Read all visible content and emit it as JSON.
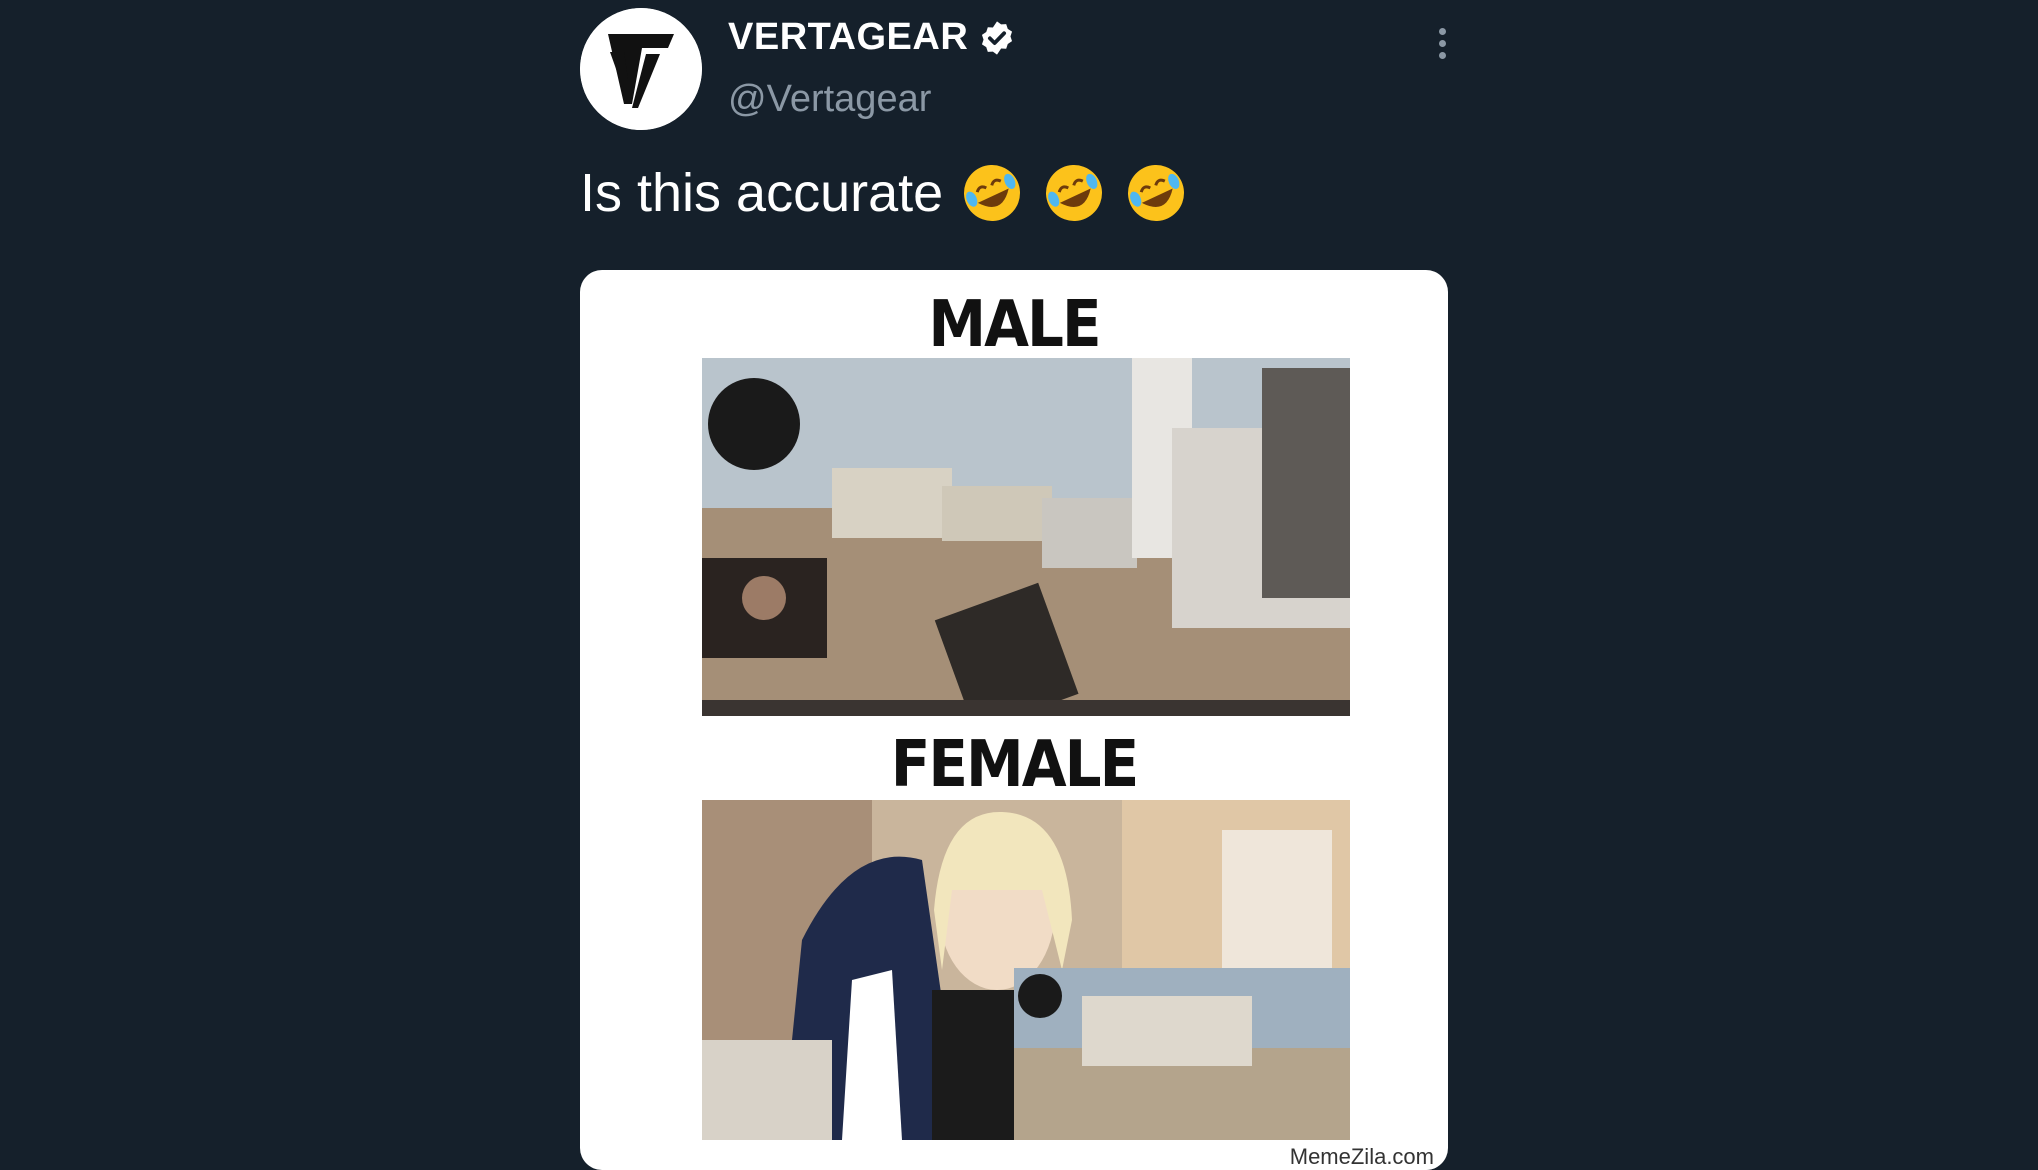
{
  "author": {
    "display_name": "VERTAGEAR",
    "handle": "@Vertagear",
    "verified": true,
    "avatar_icon": "vertagear-logo-icon"
  },
  "tweet": {
    "text": "Is this accurate",
    "emojis": [
      "rolling-on-floor-laughing-icon",
      "rolling-on-floor-laughing-icon",
      "rolling-on-floor-laughing-icon"
    ]
  },
  "media": {
    "panels": [
      {
        "label": "MALE",
        "content": "gameplay-screenshot-with-small-webcam"
      },
      {
        "label": "FEMALE",
        "content": "large-webcam-with-small-gameplay"
      }
    ],
    "watermark": "MemeZila.com"
  },
  "colors": {
    "background": "#15202b",
    "secondary_text": "#8b98a5",
    "card": "#ffffff"
  }
}
